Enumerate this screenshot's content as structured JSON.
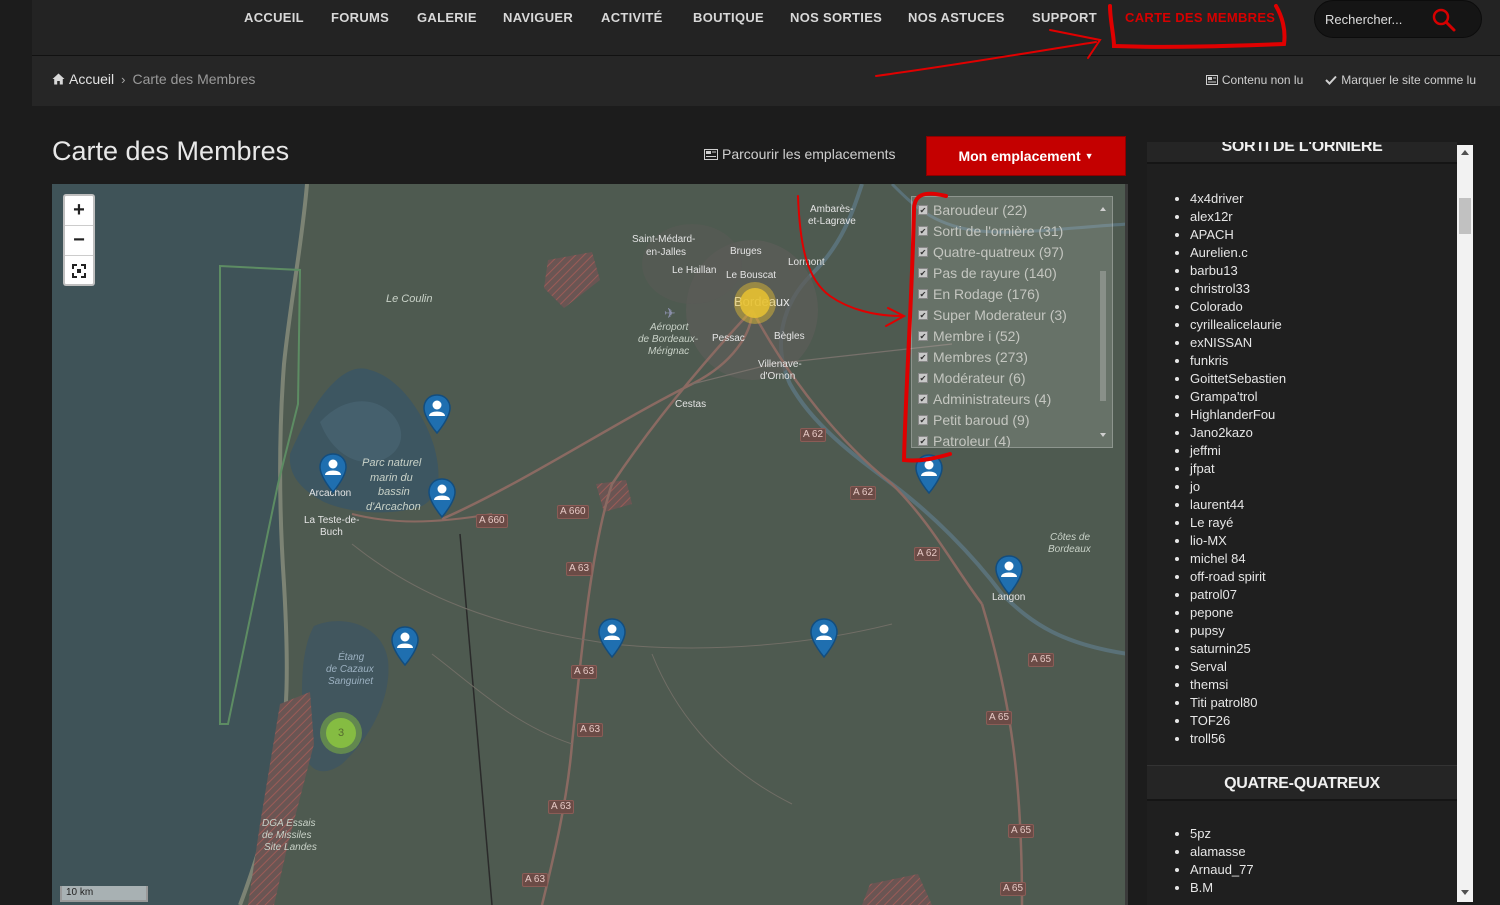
{
  "nav": {
    "items": [
      "ACCUEIL",
      "FORUMS",
      "GALERIE",
      "NAVIGUER",
      "ACTIVITÉ",
      "BOUTIQUE",
      "NOS SORTIES",
      "NOS ASTUCES",
      "SUPPORT",
      "CARTE DES MEMBRES"
    ],
    "active": "CARTE DES MEMBRES",
    "search_placeholder": "Rechercher..."
  },
  "breadcrumb": {
    "home": "Accueil",
    "current": "Carte des Membres",
    "unread": "Contenu non lu",
    "mark_read": "Marquer le site comme lu"
  },
  "page": {
    "title": "Carte des Membres",
    "browse_label": "Parcourir les emplacements",
    "location_button": "Mon emplacement"
  },
  "map": {
    "zoom_in": "+",
    "zoom_out": "−",
    "scale": "10 km",
    "places": [
      "Ambarès-et-Lagrave",
      "Saint-Médard-en-Jalles",
      "Bruges",
      "Le Haillan",
      "Le Bouscat",
      "Lormont",
      "Bordeaux",
      "Aéroport de Bordeaux-Mérignac",
      "Pessac",
      "Bègles",
      "Villenave-d'Ornon",
      "Cestas",
      "Le Coulin",
      "Parc naturel marin du bassin d'Arcachon",
      "Arcachon",
      "La Teste-de-Buch",
      "Étang de Cazaux Sanguinet",
      "DGA Essais de Missiles Site Landes",
      "Langon",
      "Côtes de Bordeaux"
    ],
    "roads": [
      "A 62",
      "A 62",
      "A 62",
      "A 660",
      "A 660",
      "A 63",
      "A 63",
      "A 63",
      "A 63",
      "A 63",
      "A 65",
      "A 65",
      "A 65",
      "A 65"
    ],
    "cluster_count": "3",
    "groups": [
      {
        "label": "Baroudeur (22)",
        "checked": true
      },
      {
        "label": "Sorti de l'ornière (31)",
        "checked": true
      },
      {
        "label": "Quatre-quatreux (97)",
        "checked": true
      },
      {
        "label": "Pas de rayure (140)",
        "checked": true
      },
      {
        "label": "En Rodage (176)",
        "checked": true
      },
      {
        "label": "Super Moderateur (3)",
        "checked": true
      },
      {
        "label": "Membre i (52)",
        "checked": true
      },
      {
        "label": "Membres (273)",
        "checked": true
      },
      {
        "label": "Modérateur (6)",
        "checked": true
      },
      {
        "label": "Administrateurs (4)",
        "checked": true
      },
      {
        "label": "Petit baroud (9)",
        "checked": true
      },
      {
        "label": "Patroleur (4)",
        "checked": true
      }
    ]
  },
  "sidebar": {
    "section1_title": "SORTI DE L'ORNIÈRE",
    "section1_members": [
      "4x4driver",
      "alex12r",
      "APACH",
      "Aurelien.c",
      "barbu13",
      "christrol33",
      "Colorado",
      "cyrillealicelaurie",
      "exNISSAN",
      "funkris",
      "GoittetSebastien",
      "Grampa'trol",
      "HighlanderFou",
      "Jano2kazo",
      "jeffmi",
      "jfpat",
      "jo",
      "laurent44",
      "Le rayé",
      "lio-MX",
      "michel 84",
      "off-road spirit",
      "patrol07",
      "pepone",
      "pupsy",
      "saturnin25",
      "Serval",
      "themsi",
      "Titi patrol80",
      "TOF26",
      "troll56"
    ],
    "section2_title": "QUATRE-QUATREUX",
    "section2_members": [
      "5pz",
      "alamasse",
      "Arnaud_77",
      "B.M"
    ]
  },
  "colors": {
    "accent_red": "#d60000",
    "button_red": "#c40000",
    "marker_blue": "#1f6fb0",
    "cluster_yellow": "#e8c231",
    "cluster_green": "#8cc63f"
  }
}
